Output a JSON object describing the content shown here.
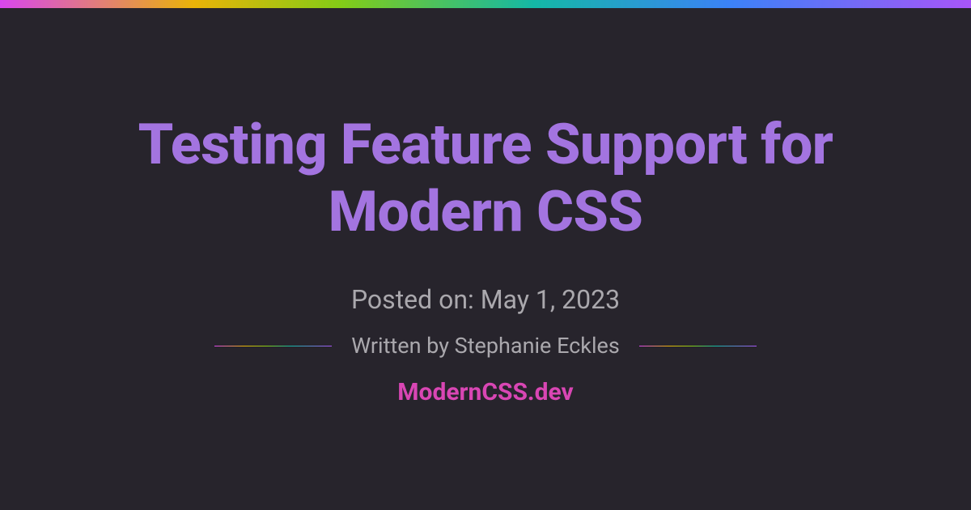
{
  "title": "Testing Feature Support for Modern CSS",
  "posted_label": "Posted on: May 1, 2023",
  "author_label": "Written by Stephanie Eckles",
  "site_name": "ModernCSS.dev",
  "colors": {
    "background": "#27242c",
    "title": "#a374e0",
    "muted_text": "#aaa8ad",
    "brand": "#d946b4"
  }
}
